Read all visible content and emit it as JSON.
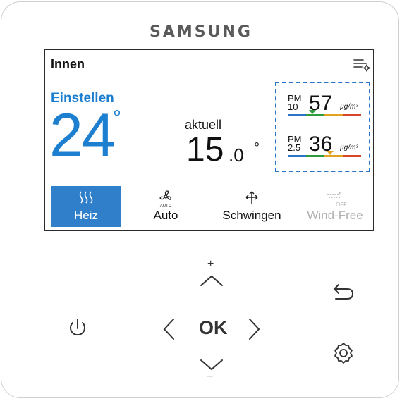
{
  "brand": "SAMSUNG",
  "screen": {
    "title": "Innen",
    "setpoint": {
      "label": "Einstellen",
      "value": "24",
      "degree": "°"
    },
    "current": {
      "label": "aktuell",
      "value": "15",
      "decimal": ".0",
      "degree": "°"
    },
    "pm": [
      {
        "label_top": "PM",
        "label_bottom": "10",
        "value": "57",
        "unit": "µg/m³",
        "level_color": "#2e9b3c"
      },
      {
        "label_top": "PM",
        "label_bottom": "2.5",
        "value": "36",
        "unit": "µg/m³",
        "level_color": "#e0a21f"
      }
    ],
    "modes": [
      {
        "label": "Heiz",
        "icon": "heat-icon",
        "state": "active"
      },
      {
        "label": "Auto",
        "icon": "fan-icon",
        "state": "normal"
      },
      {
        "label": "Schwingen",
        "icon": "swing-icon",
        "state": "normal"
      },
      {
        "label": "Wind-Free",
        "icon": "wind-free-icon",
        "state": "inactive",
        "icon_text": "OFF"
      }
    ]
  },
  "controls": {
    "ok": "OK",
    "plus": "+",
    "minus": "−"
  },
  "colors": {
    "accent": "#1c7fd0",
    "active_mode_bg": "#2f7fcb",
    "pm_box_border": "#2a73c9",
    "bar_segments": [
      "#2a73c9",
      "#2e9b3c",
      "#e0a21f",
      "#d9452b"
    ]
  }
}
